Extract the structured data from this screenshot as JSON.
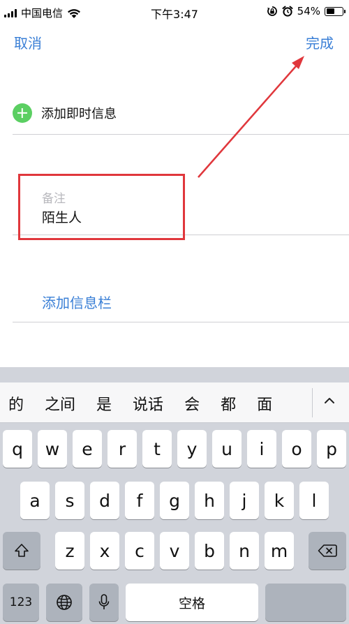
{
  "status_bar": {
    "carrier": "中国电信",
    "time": "下午3:47",
    "battery": "54%",
    "battery_level": 0.54
  },
  "nav": {
    "cancel": "取消",
    "done": "完成"
  },
  "form": {
    "add_instant_message": "添加即时信息",
    "note_label": "备注",
    "note_value": "陌生人",
    "add_field": "添加信息栏"
  },
  "accent_color": "#3a7fd6",
  "highlight_color": "#e0373c",
  "keyboard": {
    "candidates": [
      "的",
      "之间",
      "是",
      "说话",
      "会",
      "都",
      "面"
    ],
    "row1": [
      "q",
      "w",
      "e",
      "r",
      "t",
      "y",
      "u",
      "i",
      "o",
      "p"
    ],
    "row2": [
      "a",
      "s",
      "d",
      "f",
      "g",
      "h",
      "j",
      "k",
      "l"
    ],
    "row3": [
      "z",
      "x",
      "c",
      "v",
      "b",
      "n",
      "m"
    ],
    "numbers": "123",
    "space": "空格"
  }
}
